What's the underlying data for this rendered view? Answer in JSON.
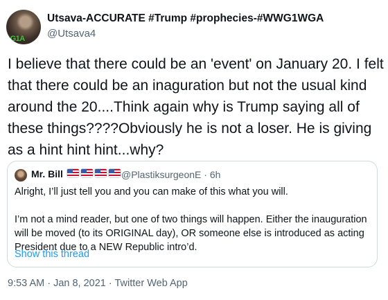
{
  "author": {
    "display_name": "Utsava-ACCURATE #Trump #prophecies-#WWG1WGA",
    "handle": "@Utsava4",
    "avatar_tag": "1G1A"
  },
  "tweet_text": "I believe that there could be an 'event' on January 20. I felt that there could be an inaguration but not the usual kind around the 20....Think again why is Trump saying all of these things????Obviously he is not a loser. He is giving as a hint hint hint...why?",
  "quoted_tweet": {
    "display_name": "Mr. Bill",
    "flags": [
      "us-flag",
      "us-flag",
      "us-flag",
      "us-flag"
    ],
    "meta": "@PlastiksurgeonE · 6h",
    "paragraph_1": "Alright, I’ll just tell you and you can make of this what you will.",
    "paragraph_2": "I’m not a mind reader, but one of two things will happen. Either the inauguration will be moved (to its ORIGINAL day), OR someone else is introduced as acting President due to a NEW Republic intro’d.",
    "show_thread": "Show this thread"
  },
  "footer": {
    "timestamp": "9:53 AM · Jan 8, 2021 · Twitter Web App"
  },
  "colors": {
    "link": "#1d9bf0",
    "secondary_text": "#536471",
    "border": "#cfd9de"
  }
}
